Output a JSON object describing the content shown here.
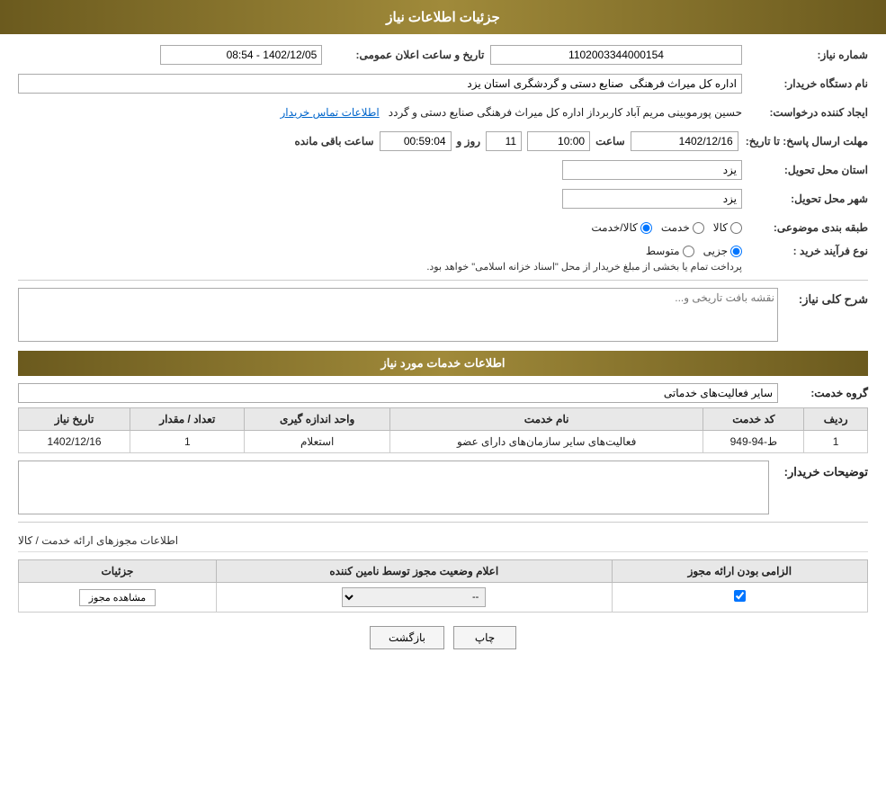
{
  "page": {
    "title": "جزئیات اطلاعات نیاز",
    "sections": {
      "main_info": {
        "need_number_label": "شماره نیاز:",
        "need_number_value": "1102003344000154",
        "announce_datetime_label": "تاریخ و ساعت اعلان عمومی:",
        "announce_datetime_value": "1402/12/05 - 08:54",
        "buyer_name_label": "نام دستگاه خریدار:",
        "buyer_name_value": "اداره کل میراث فرهنگی  صنایع دستی و گردشگری استان یزد",
        "creator_label": "ایجاد کننده درخواست:",
        "creator_value": "حسین پورموبینی مریم آباد کاربرداز اداره کل میراث فرهنگی  صنایع دستی و گردد",
        "creator_link": "اطلاعات تماس خریدار",
        "response_deadline_label": "مهلت ارسال پاسخ: تا تاریخ:",
        "response_date": "1402/12/16",
        "response_time_label": "ساعت",
        "response_time": "10:00",
        "response_day_label": "روز و",
        "response_days": "11",
        "remaining_time_label": "ساعت باقی مانده",
        "remaining_time": "00:59:04",
        "province_label": "استان محل تحویل:",
        "province_value": "یزد",
        "city_label": "شهر محل تحویل:",
        "city_value": "یزد",
        "category_label": "طبقه بندی موضوعی:",
        "category_kala": "کالا",
        "category_khedmat": "خدمت",
        "category_kala_khedmat": "کالا/خدمت",
        "procurement_label": "نوع فرآیند خرید :",
        "procurement_jazei": "جزیی",
        "procurement_motawaset": "متوسط",
        "procurement_note": "پرداخت تمام یا بخشی از مبلغ خریدار از محل \"اسناد خزانه اسلامی\" خواهد بود."
      },
      "general_description": {
        "label": "شرح کلی نیاز:",
        "placeholder": "نقشه بافت تاریخی و..."
      },
      "services_info": {
        "title": "اطلاعات خدمات مورد نیاز",
        "service_group_label": "گروه خدمت:",
        "service_group_value": "سایر فعالیت‌های خدماتی"
      },
      "services_table": {
        "columns": [
          "ردیف",
          "کد خدمت",
          "نام خدمت",
          "واحد اندازه گیری",
          "تعداد / مقدار",
          "تاریخ نیاز"
        ],
        "rows": [
          {
            "row": "1",
            "code": "ط-94-949",
            "name": "فعالیت‌های سایر سازمان‌های دارای عضو",
            "unit": "استعلام",
            "quantity": "1",
            "date": "1402/12/16"
          }
        ]
      },
      "buyer_description": {
        "label": "توضیحات خریدار:",
        "value": ""
      },
      "license_info": {
        "section_title": "اطلاعات مجوزهای ارائه خدمت / کالا",
        "columns": [
          "الزامی بودن ارائه مجوز",
          "اعلام وضعیت مجوز توسط نامین کننده",
          "جزئیات"
        ],
        "rows": [
          {
            "required": true,
            "status_value": "--",
            "details_btn": "مشاهده مجوز"
          }
        ]
      }
    },
    "buttons": {
      "print": "چاپ",
      "back": "بازگشت"
    }
  }
}
